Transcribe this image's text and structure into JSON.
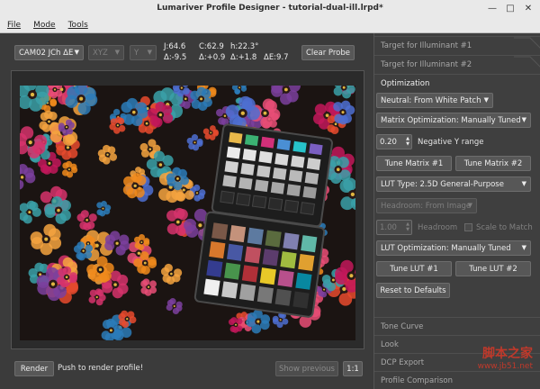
{
  "window": {
    "title": "Lumariver Profile Designer - tutorial-dual-ill.lrpd*"
  },
  "menu": [
    "File",
    "Mode",
    "Tools"
  ],
  "toolbar": {
    "colorspace_select": "CAM02 JCh ΔE",
    "select2": "XYZ",
    "select3": "Y",
    "readout": {
      "J": "J:64.6",
      "C": "C:62.9",
      "h": "h:22.3°",
      "dJ": "Δ:-9.5",
      "dC": "Δ:+0.9",
      "dh": "Δ:+1.8",
      "dE": "ΔE:9.7"
    },
    "clear_probe": "Clear Probe"
  },
  "bottom": {
    "render": "Render",
    "status": "Push to render profile!",
    "show_previous": "Show previous",
    "zoom": "1:1"
  },
  "panel": {
    "tabs_top": [
      "Target for Illuminant #1",
      "Target for Illuminant #2"
    ],
    "active_tab": "Optimization",
    "neutral_select": "Neutral: From White Patch",
    "matrix_select": "Matrix Optimization: Manually Tuned",
    "negative_y_value": "0.20",
    "negative_y_label": "Negative Y range",
    "tune_matrix_1": "Tune Matrix #1",
    "tune_matrix_2": "Tune Matrix #2",
    "lut_type_select": "LUT Type: 2.5D General-Purpose",
    "headroom_select": "Headroom: From Image",
    "headroom_value": "1.00",
    "headroom_label": "Headroom",
    "scale_to_match": "Scale to Match",
    "lut_opt_select": "LUT Optimization: Manually Tuned",
    "tune_lut_1": "Tune LUT #1",
    "tune_lut_2": "Tune LUT #2",
    "reset": "Reset to Defaults",
    "tabs_bottom": [
      "Tone Curve",
      "Look",
      "DCP Export",
      "Profile Comparison"
    ]
  },
  "watermark": {
    "logo": "脚本之家",
    "url": "www.jb51.net"
  },
  "icons": [
    "minimize-icon",
    "maximize-icon",
    "close-icon",
    "dropdown-arrow-icon",
    "spin-stepper-icon"
  ]
}
